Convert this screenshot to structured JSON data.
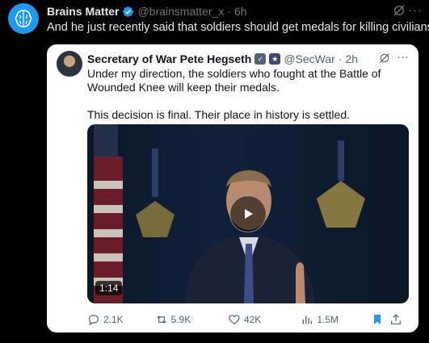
{
  "outer_post": {
    "author_name": "Brains Matter",
    "handle": "@brainsmatter_x",
    "separator": "·",
    "time": "6h",
    "text": "And he just recently said that soldiers should get medals for killing civilians."
  },
  "quoted_post": {
    "author_name": "Secretary of War Pete Hegseth",
    "handle": "@SecWar",
    "separator": "·",
    "time": "2h",
    "paragraph1": "Under my direction, the soldiers who fought at the Battle of Wounded Knee will keep their medals.",
    "paragraph2": "This decision is final. Their place in history is settled.",
    "video": {
      "duration": "1:14"
    },
    "actions": {
      "replies": "2.1K",
      "reposts": "5.9K",
      "likes": "42K",
      "views": "1.5M"
    }
  },
  "colors": {
    "background": "#000000",
    "accent": "#1d9bf0",
    "card": "#ffffff",
    "muted": "#536471"
  },
  "icons": [
    "brain-avatar-icon",
    "verified-icon",
    "grok-icon",
    "more-icon",
    "gov-badge-icon",
    "play-icon",
    "reply-icon",
    "repost-icon",
    "like-icon",
    "views-icon",
    "bookmark-icon",
    "share-icon"
  ]
}
